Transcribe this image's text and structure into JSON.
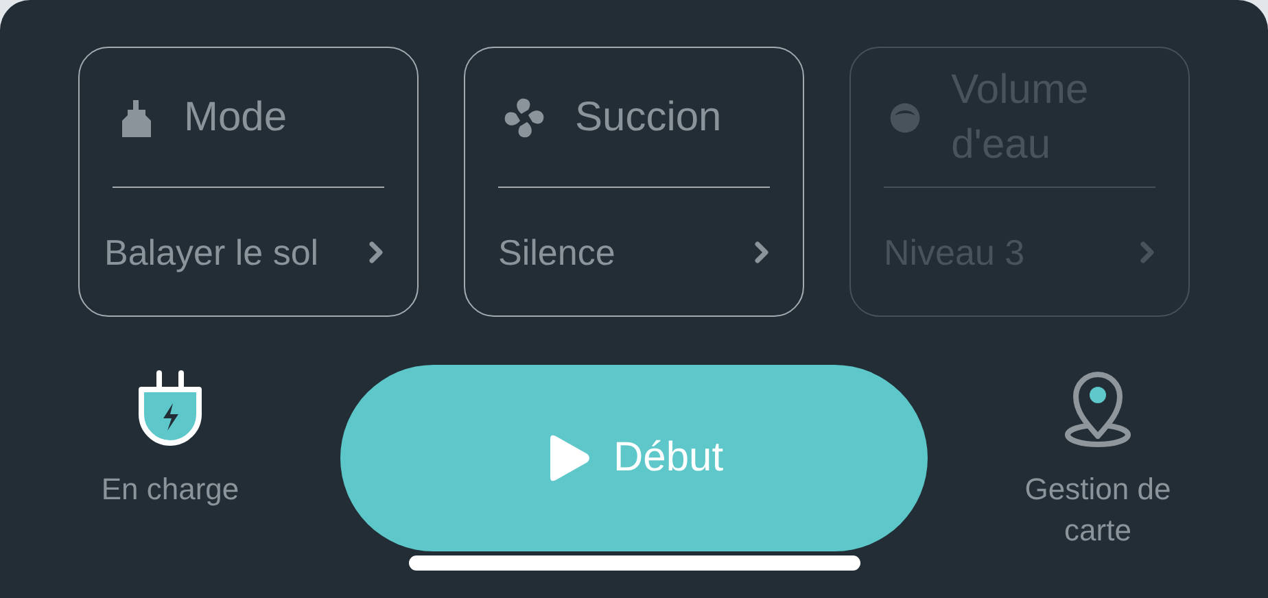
{
  "settings": [
    {
      "kind": "mode",
      "title": "Mode",
      "value": "Balayer le sol",
      "disabled": false
    },
    {
      "kind": "suction",
      "title": "Succion",
      "value": "Silence",
      "disabled": false
    },
    {
      "kind": "water",
      "title": "Volume d'eau",
      "value": "Niveau 3",
      "disabled": true
    }
  ],
  "charging": {
    "label": "En charge"
  },
  "start_button": {
    "label": "Début"
  },
  "map_management": {
    "label": "Gestion de carte"
  }
}
